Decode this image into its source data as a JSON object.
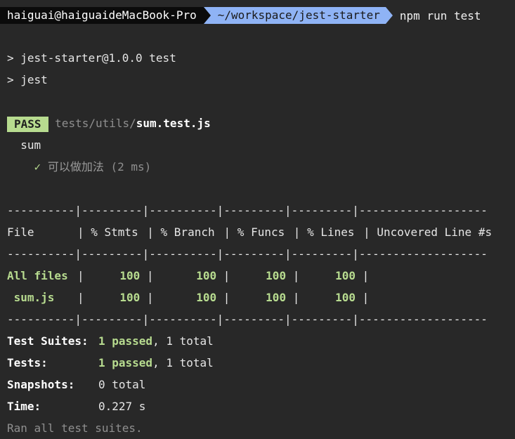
{
  "prompt": {
    "user_host": "haiguai@haiguaideMacBook-Pro",
    "path": "~/workspace/jest-starter",
    "command": "npm run test"
  },
  "script_lines": [
    "> jest-starter@1.0.0 test",
    "> jest"
  ],
  "result": {
    "badge": "PASS",
    "path_dir": "tests/utils/",
    "path_file": "sum.test.js",
    "suite": "sum",
    "check_mark": "✓",
    "test_name": "可以做加法",
    "test_time": "(2 ms)"
  },
  "coverage": {
    "divider": "----------|---------|----------|---------|---------|-------------------",
    "header": [
      "File",
      "% Stmts",
      "% Branch",
      "% Funcs",
      "% Lines",
      "Uncovered Line #s"
    ],
    "rows": [
      {
        "file": "All files",
        "stmts": "100",
        "branch": "100",
        "funcs": "100",
        "lines": "100",
        "uncovered": ""
      },
      {
        "file": " sum.js",
        "stmts": "100",
        "branch": "100",
        "funcs": "100",
        "lines": "100",
        "uncovered": ""
      }
    ]
  },
  "summary": {
    "suites_label": "Test Suites:",
    "suites_passed": "1 passed",
    "suites_total": ", 1 total",
    "tests_label": "Tests:",
    "tests_passed": "1 passed",
    "tests_total": ", 1 total",
    "snapshots_label": "Snapshots:",
    "snapshots_value": "0 total",
    "time_label": "Time:",
    "time_value": "0.227 s",
    "footer": "Ran all test suites."
  },
  "colors": {
    "background": "#282828",
    "pass_green": "#b7db8f",
    "path_segment_blue": "#8fb3f5",
    "user_segment_black": "#0b0b0b"
  }
}
